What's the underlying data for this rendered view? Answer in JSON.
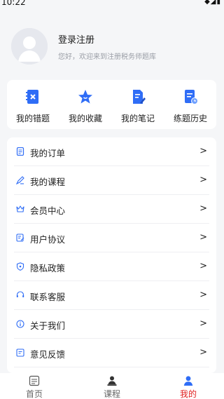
{
  "status_bar": {
    "time": "10:22",
    "icons": "◆◢▮"
  },
  "profile": {
    "name": "登录注册",
    "subtitle": "您好，欢迎来到注册税务师题库"
  },
  "quick_actions": [
    {
      "label": "我的错题",
      "icon": "wrong-questions-icon"
    },
    {
      "label": "我的收藏",
      "icon": "star-icon"
    },
    {
      "label": "我的笔记",
      "icon": "note-pen-icon"
    },
    {
      "label": "练题历史",
      "icon": "history-icon"
    }
  ],
  "menu": [
    {
      "label": "我的订单",
      "icon": "order-icon"
    },
    {
      "label": "我的课程",
      "icon": "course-icon"
    },
    {
      "label": "会员中心",
      "icon": "crown-icon"
    },
    {
      "label": "用户协议",
      "icon": "agreement-icon"
    },
    {
      "label": "隐私政策",
      "icon": "shield-icon"
    },
    {
      "label": "联系客服",
      "icon": "headset-icon"
    },
    {
      "label": "关于我们",
      "icon": "info-icon"
    },
    {
      "label": "意见反馈",
      "icon": "feedback-icon"
    }
  ],
  "menu_chevron": ">",
  "tabbar": [
    {
      "label": "首页",
      "icon": "home-icon",
      "active": false
    },
    {
      "label": "课程",
      "icon": "course-tab-icon",
      "active": false
    },
    {
      "label": "我的",
      "icon": "user-icon",
      "active": true
    }
  ],
  "colors": {
    "accent": "#2f6df6",
    "active_tab": "#e02020",
    "background": "#f5f6f8"
  }
}
